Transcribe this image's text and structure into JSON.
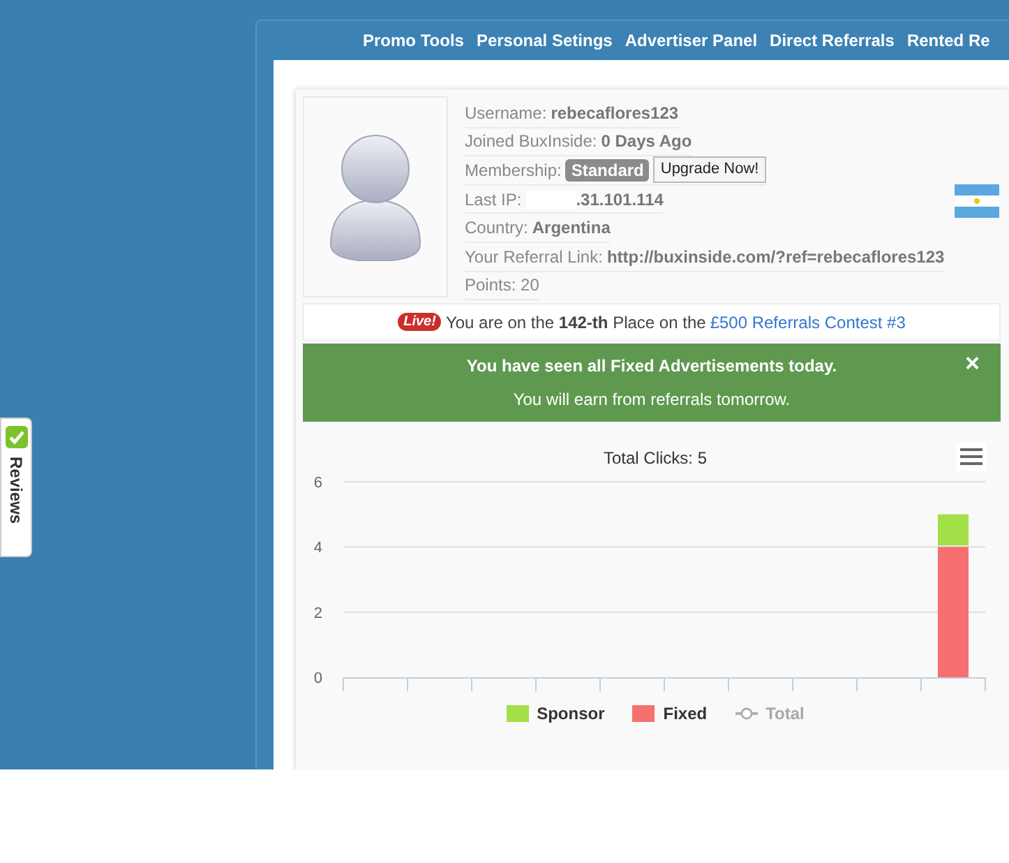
{
  "nav": [
    {
      "label": "Promo Tools"
    },
    {
      "label": "Personal Setings"
    },
    {
      "label": "Advertiser Panel"
    },
    {
      "label": "Direct Referrals"
    },
    {
      "label": "Rented Re"
    }
  ],
  "reviews_tab": {
    "label": "Reviews"
  },
  "profile": {
    "rows": [
      {
        "label": "Username:",
        "value": "rebecaflores123"
      },
      {
        "label": "Joined BuxInside:",
        "value": "0 Days Ago"
      },
      {
        "label": "Membership:",
        "badge": "Standard",
        "button": "Upgrade Now!"
      },
      {
        "label": "Last IP:",
        "value": ".31.101.114",
        "redacted": true
      },
      {
        "label": "Country:",
        "value": "Argentina"
      },
      {
        "label": "Your Referral Link:",
        "value": "http://buxinside.com/?ref=rebecaflores123"
      },
      {
        "label": "Points: 20"
      }
    ]
  },
  "contest": {
    "badge": "Live!",
    "text": "You are on the **142-th** Place on the",
    "link": "£500 Referrals Contest #3"
  },
  "alert": {
    "lines": [
      "You have seen all Fixed Advertisements today.",
      "You will earn from referrals tomorrow."
    ],
    "close": "×"
  },
  "chart": {
    "chart_data": {
      "type": "bar",
      "title": "Total Clicks: 5",
      "stacked": true,
      "ylim": [
        0,
        6
      ],
      "yticks": [
        0,
        2,
        4,
        6
      ],
      "legend": "bottom",
      "series": [
        {
          "name": "Sponsor",
          "color": "#a3e048",
          "values": [
            0,
            0,
            0,
            0,
            0,
            0,
            0,
            0,
            0,
            1
          ]
        },
        {
          "name": "Fixed",
          "color": "#f77070",
          "values": [
            0,
            0,
            0,
            0,
            0,
            0,
            0,
            0,
            0,
            4
          ]
        }
      ]
    },
    "legend_extra": [
      {
        "label": "Total",
        "visible": false
      }
    ]
  }
}
